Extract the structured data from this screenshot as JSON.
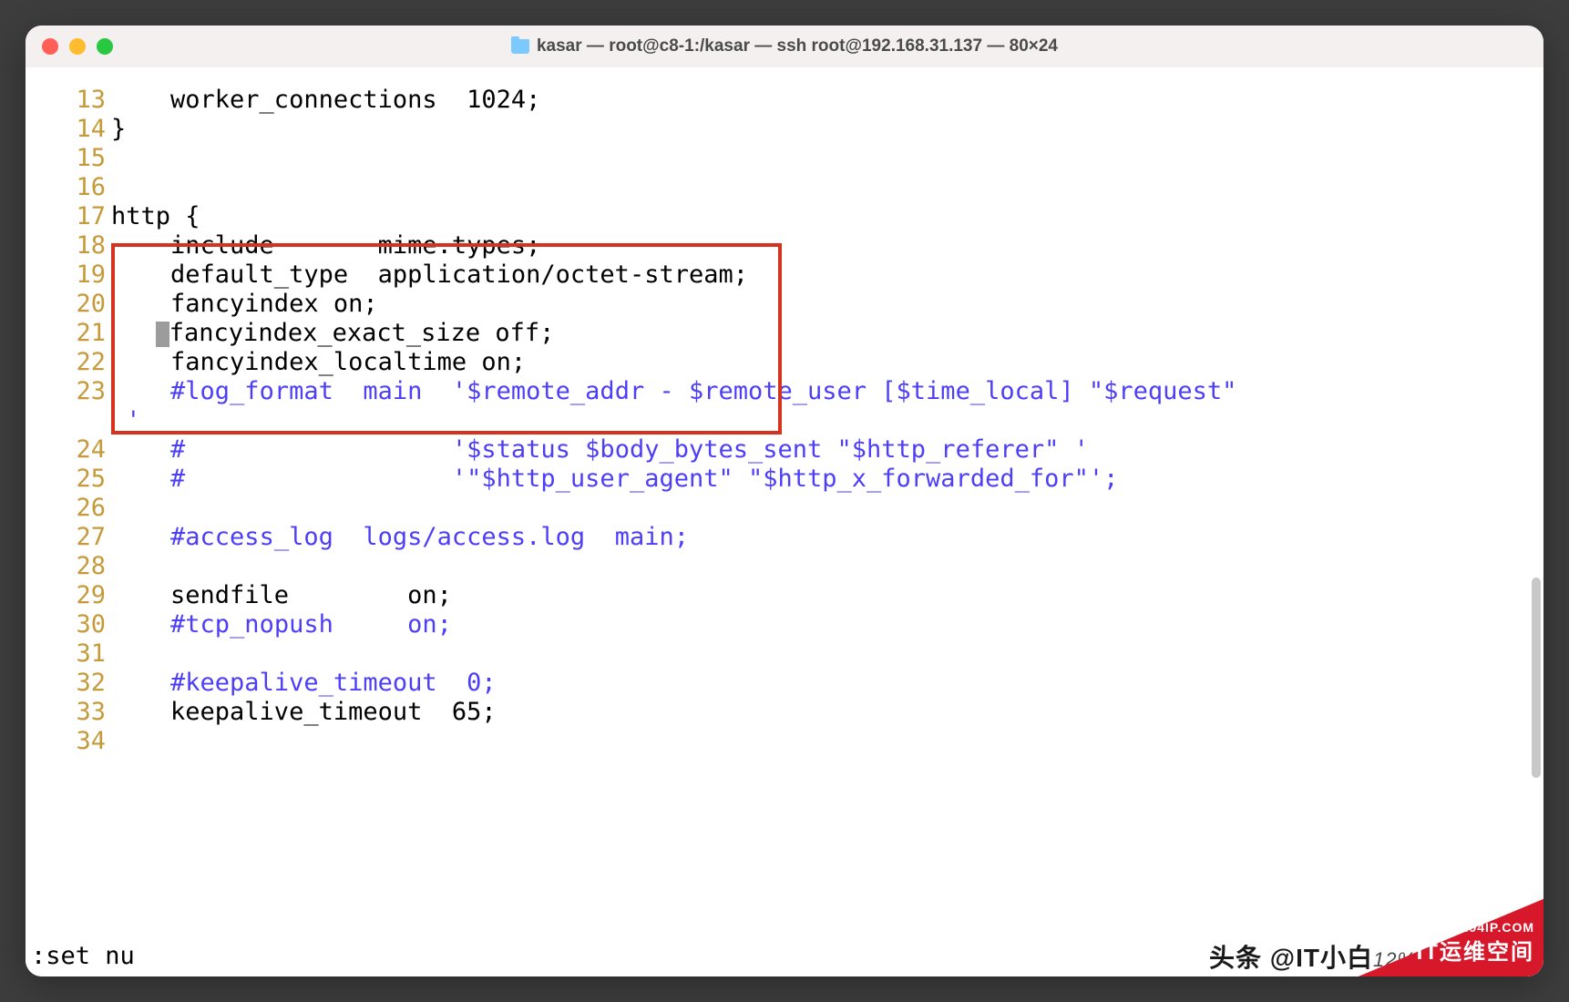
{
  "window": {
    "title": "kasar — root@c8-1:/kasar — ssh root@192.168.31.137 — 80×24"
  },
  "editor": {
    "lines": [
      {
        "num": "13",
        "segments": [
          {
            "text": "    worker_connections  1024;",
            "cls": ""
          }
        ]
      },
      {
        "num": "14",
        "segments": [
          {
            "text": "}",
            "cls": ""
          }
        ]
      },
      {
        "num": "15",
        "segments": [
          {
            "text": "",
            "cls": ""
          }
        ]
      },
      {
        "num": "16",
        "segments": [
          {
            "text": "",
            "cls": ""
          }
        ]
      },
      {
        "num": "17",
        "segments": [
          {
            "text": "http {",
            "cls": ""
          }
        ]
      },
      {
        "num": "18",
        "segments": [
          {
            "text": "    include       mime.types;",
            "cls": ""
          }
        ]
      },
      {
        "num": "19",
        "segments": [
          {
            "text": "    default_type  application/octet-stream;",
            "cls": ""
          }
        ]
      },
      {
        "num": "20",
        "segments": [
          {
            "text": "    fancyindex on;",
            "cls": ""
          }
        ]
      },
      {
        "num": "21",
        "segments": [
          {
            "text": "   ",
            "cls": ""
          },
          {
            "cursor": true
          },
          {
            "text": "fancyindex_exact_size off;",
            "cls": ""
          }
        ]
      },
      {
        "num": "22",
        "segments": [
          {
            "text": "    fancyindex_localtime on;",
            "cls": ""
          }
        ]
      },
      {
        "num": "23",
        "segments": [
          {
            "text": "    ",
            "cls": ""
          },
          {
            "text": "#log_format  main  '$remote_addr - $remote_user [$time_local] \"$request\"",
            "cls": "comment"
          }
        ]
      },
      {
        "num": "",
        "segments": [
          {
            "text": " '",
            "cls": "comment"
          }
        ]
      },
      {
        "num": "24",
        "segments": [
          {
            "text": "    ",
            "cls": ""
          },
          {
            "text": "#                  '$status $body_bytes_sent \"$http_referer\" '",
            "cls": "comment"
          }
        ]
      },
      {
        "num": "25",
        "segments": [
          {
            "text": "    ",
            "cls": ""
          },
          {
            "text": "#                  '\"$http_user_agent\" \"$http_x_forwarded_for\"';",
            "cls": "comment"
          }
        ]
      },
      {
        "num": "26",
        "segments": [
          {
            "text": "",
            "cls": ""
          }
        ]
      },
      {
        "num": "27",
        "segments": [
          {
            "text": "    ",
            "cls": ""
          },
          {
            "text": "#access_log  logs/access.log  main;",
            "cls": "comment"
          }
        ]
      },
      {
        "num": "28",
        "segments": [
          {
            "text": "",
            "cls": ""
          }
        ]
      },
      {
        "num": "29",
        "segments": [
          {
            "text": "    sendfile        on;",
            "cls": ""
          }
        ]
      },
      {
        "num": "30",
        "segments": [
          {
            "text": "    ",
            "cls": ""
          },
          {
            "text": "#tcp_nopush     on;",
            "cls": "comment"
          }
        ]
      },
      {
        "num": "31",
        "segments": [
          {
            "text": "",
            "cls": ""
          }
        ]
      },
      {
        "num": "32",
        "segments": [
          {
            "text": "    ",
            "cls": ""
          },
          {
            "text": "#keepalive_timeout  0;",
            "cls": "comment"
          }
        ]
      },
      {
        "num": "33",
        "segments": [
          {
            "text": "    keepalive_timeout  65;",
            "cls": ""
          }
        ]
      },
      {
        "num": "34",
        "segments": [
          {
            "text": "",
            "cls": ""
          }
        ]
      }
    ],
    "status_line": ":set nu"
  },
  "watermark": {
    "cn_text": "头条 @IT小白",
    "pct": "12%",
    "corner_small": "WWW.94IP.COM",
    "corner_large": "IT运维空间"
  }
}
